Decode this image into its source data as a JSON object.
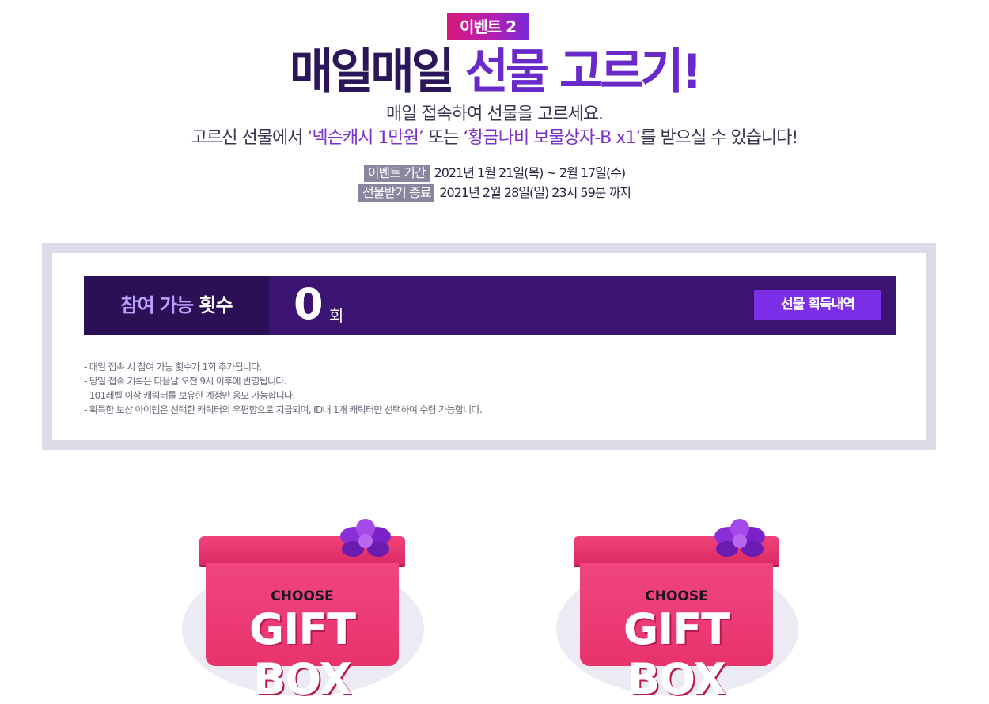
{
  "event_tag": "이벤트 2",
  "title": {
    "part1": "매일매일 ",
    "part2": "선물 고르기!"
  },
  "subtitle1": "매일 접속하여 선물을 고르세요.",
  "subtitle2": {
    "pre": "고르신 선물에서 ",
    "hl1": "‘넥슨캐시 1만원’",
    "mid": " 또는 ",
    "hl2": "‘황금나비 보물상자-B x1’",
    "post": "를 받으실 수 있습니다!"
  },
  "period": {
    "event_label": "이벤트 기간",
    "event_value": "2021년 1월 21일(목) ~ 2월 17일(수)",
    "claim_label": "선물받기 종료",
    "claim_value": "2021년 2월 28일(일) 23시 59분 까지"
  },
  "counter": {
    "label_a": "참여 가능 ",
    "label_b": "횟수",
    "count": "0",
    "unit": "회",
    "history_button": "선물 획득내역"
  },
  "notes": [
    "- 매일 접속 시 참여 가능 횟수가 1회 추가됩니다.",
    "- 당일 접속 기록은 다음날 오전 9시 이후에 반영됩니다.",
    "- 101레벨 이상 캐릭터를 보유한 계정만 응모 가능합니다.",
    "- 획득한 보상 아이템은 선택한 캐릭터의 우편함으로 지급되며, ID내 1개 캐릭터만 선택하여 수령 가능합니다."
  ],
  "gift_boxes": [
    {
      "choose": "CHOOSE",
      "label": "GIFT BOX"
    },
    {
      "choose": "CHOOSE",
      "label": "GIFT BOX"
    }
  ],
  "colors": {
    "dark_purple": "#2a1659",
    "accent_purple": "#6a29c9",
    "button_purple": "#7b30e8",
    "gift_pink": "#e8336c"
  }
}
